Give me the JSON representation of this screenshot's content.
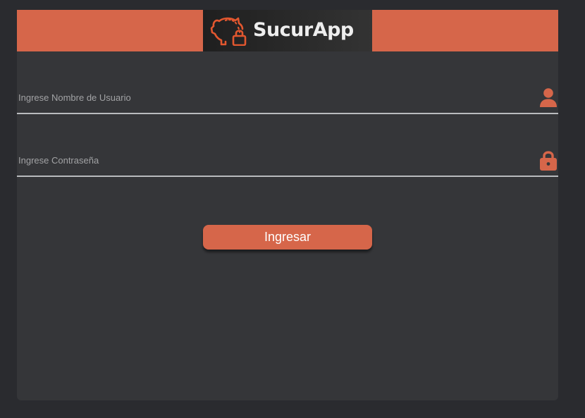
{
  "header": {
    "logo_text": "SucurApp",
    "logo_icon": "piggy-bank-lock-icon"
  },
  "form": {
    "username": {
      "placeholder": "Ingrese Nombre de Usuario",
      "value": "",
      "icon": "user-icon"
    },
    "password": {
      "placeholder": "Ingrese Contraseña",
      "value": "",
      "icon": "lock-icon"
    },
    "submit_label": "Ingresar"
  },
  "colors": {
    "accent": "#d6664a",
    "page_background": "#2a2b2f",
    "panel_background": "#353639",
    "logo_background": "#232323",
    "logo_text": "#eeeeee",
    "underline": "#b9bbbe"
  }
}
